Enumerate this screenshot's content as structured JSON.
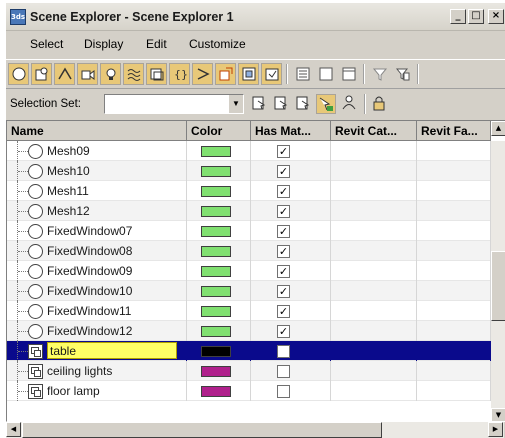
{
  "window": {
    "title": "Scene Explorer - Scene Explorer 1",
    "app_icon_text": "3ds",
    "minimize": "_",
    "maximize": "□",
    "close": "×"
  },
  "menu": [
    "Select",
    "Display",
    "Edit",
    "Customize"
  ],
  "selection_set": {
    "label": "Selection Set:",
    "value": ""
  },
  "grid": {
    "columns": [
      "Name",
      "Color",
      "Has Mat...",
      "Revit Cat...",
      "Revit Fa..."
    ],
    "rows": [
      {
        "name": "Mesh09",
        "color": "#80e070",
        "has_material": true,
        "icon": "sphere",
        "selected": false
      },
      {
        "name": "Mesh10",
        "color": "#80e070",
        "has_material": true,
        "icon": "sphere",
        "selected": false
      },
      {
        "name": "Mesh11",
        "color": "#80e070",
        "has_material": true,
        "icon": "sphere",
        "selected": false
      },
      {
        "name": "Mesh12",
        "color": "#80e070",
        "has_material": true,
        "icon": "sphere",
        "selected": false
      },
      {
        "name": "FixedWindow07",
        "color": "#80e070",
        "has_material": true,
        "icon": "sphere",
        "selected": false
      },
      {
        "name": "FixedWindow08",
        "color": "#80e070",
        "has_material": true,
        "icon": "sphere",
        "selected": false
      },
      {
        "name": "FixedWindow09",
        "color": "#80e070",
        "has_material": true,
        "icon": "sphere",
        "selected": false
      },
      {
        "name": "FixedWindow10",
        "color": "#80e070",
        "has_material": true,
        "icon": "sphere",
        "selected": false
      },
      {
        "name": "FixedWindow11",
        "color": "#80e070",
        "has_material": true,
        "icon": "sphere",
        "selected": false
      },
      {
        "name": "FixedWindow12",
        "color": "#80e070",
        "has_material": true,
        "icon": "sphere",
        "selected": false
      },
      {
        "name": "table",
        "color": "#000000",
        "has_material": false,
        "icon": "group",
        "selected": true
      },
      {
        "name": "ceiling lights",
        "color": "#b0208c",
        "has_material": false,
        "icon": "group",
        "selected": false
      },
      {
        "name": "floor lamp",
        "color": "#b0208c",
        "has_material": false,
        "icon": "group",
        "selected": false
      }
    ]
  },
  "colors": {
    "toolbar_active": "#e8c878",
    "selection_row": "#0a0a8c",
    "name_highlight": "#ffff66"
  },
  "icons": {
    "toolbar": [
      "sphere-icon",
      "geometry-icon",
      "shapes-icon",
      "camera-icon",
      "light-icon",
      "spacewarp-icon",
      "group-icon",
      "helper-icon",
      "bone-icon",
      "xref-icon",
      "container-icon",
      "frozen-icon",
      "list-view-icon",
      "blank-view-icon",
      "page-icon",
      "filter-icon",
      "filter-options-icon"
    ],
    "selection_bar": [
      "select-all-icon",
      "select-none-icon",
      "select-invert-icon",
      "sync-selection-icon",
      "hierarchy-icon",
      "lock-icon"
    ]
  }
}
